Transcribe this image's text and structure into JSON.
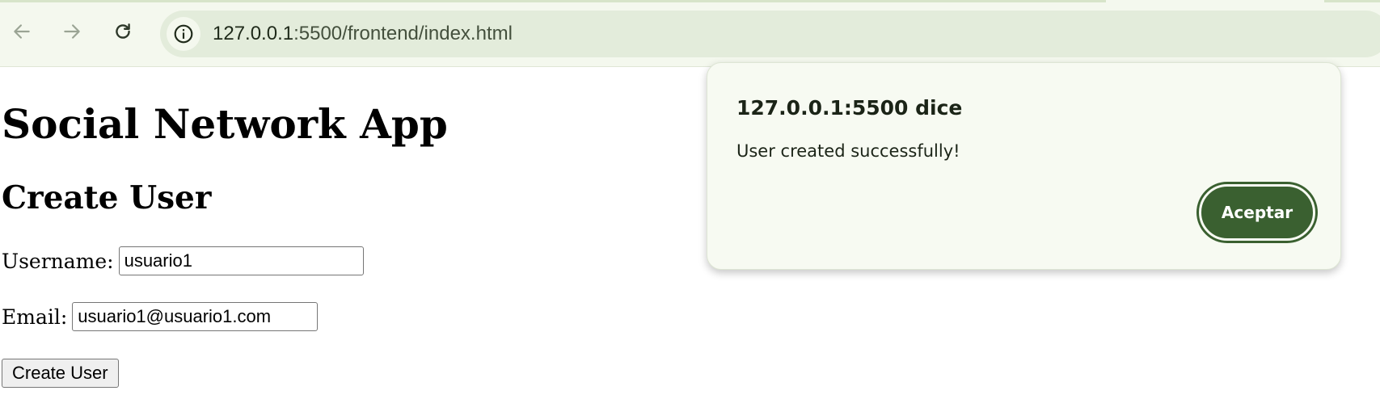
{
  "browser": {
    "url_host": "127.0.0.1",
    "url_path": ":5500/frontend/index.html",
    "back_icon": "arrow-left-icon",
    "forward_icon": "arrow-right-icon",
    "reload_icon": "reload-icon",
    "site_info_icon": "info-icon"
  },
  "page": {
    "title": "Social Network App",
    "section_title": "Create User",
    "form": {
      "username_label": "Username:",
      "username_value": "usuario1",
      "email_label": "Email:",
      "email_value": "usuario1@usuario1.com",
      "submit_label": "Create User"
    }
  },
  "dialog": {
    "title": "127.0.0.1:5500 dice",
    "message": "User created successfully!",
    "ok_label": "Aceptar",
    "accent_color": "#3a6030"
  }
}
